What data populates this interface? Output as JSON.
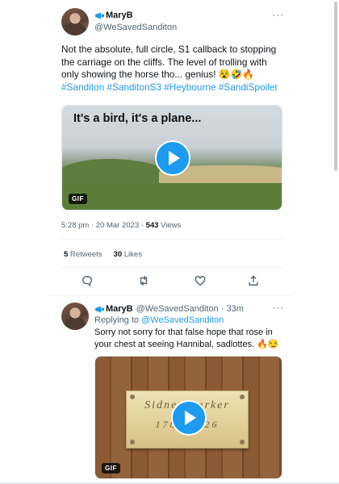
{
  "tweet1": {
    "display_name": "MaryB",
    "handle": "@WeSavedSanditon",
    "text": "Not the absolute, full circle, S1 callback to stopping the carriage on the cliffs. The level of trolling with only showing the horse tho... genius! 😵🤣🔥",
    "hashtags": "#Sanditon #SanditonS3 #Heybourne #SandiSpoiler",
    "gif_caption": "It's a bird, it's a plane...",
    "gif_badge": "GIF",
    "time": "5:28 pm · 20 Mar 2023 · ",
    "views_count": "543",
    "views_label": " Views",
    "retweets_count": "5",
    "retweets_label": " Retweets",
    "likes_count": "30",
    "likes_label": " Likes"
  },
  "tweet2": {
    "display_name": "MaryB",
    "handle": "@WeSavedSanditon · 33m",
    "replying_prefix": "Replying to ",
    "replying_to": "@WeSavedSanditon",
    "text": "Sorry not sorry for that false hope that rose in your chest at seeing Hannibal, sadlottes. 🔥😏",
    "plate_name": "Sidney Parker",
    "plate_date": "1780-1826",
    "gif_badge": "GIF"
  },
  "icons": {
    "verified": "megaphone-icon",
    "more": "more-icon",
    "reply": "reply-icon",
    "retweet": "retweet-icon",
    "like": "like-icon",
    "share": "share-icon",
    "play": "play-icon"
  },
  "colors": {
    "accent": "#1d9bf0",
    "text": "#0f1419",
    "muted": "#536471"
  }
}
